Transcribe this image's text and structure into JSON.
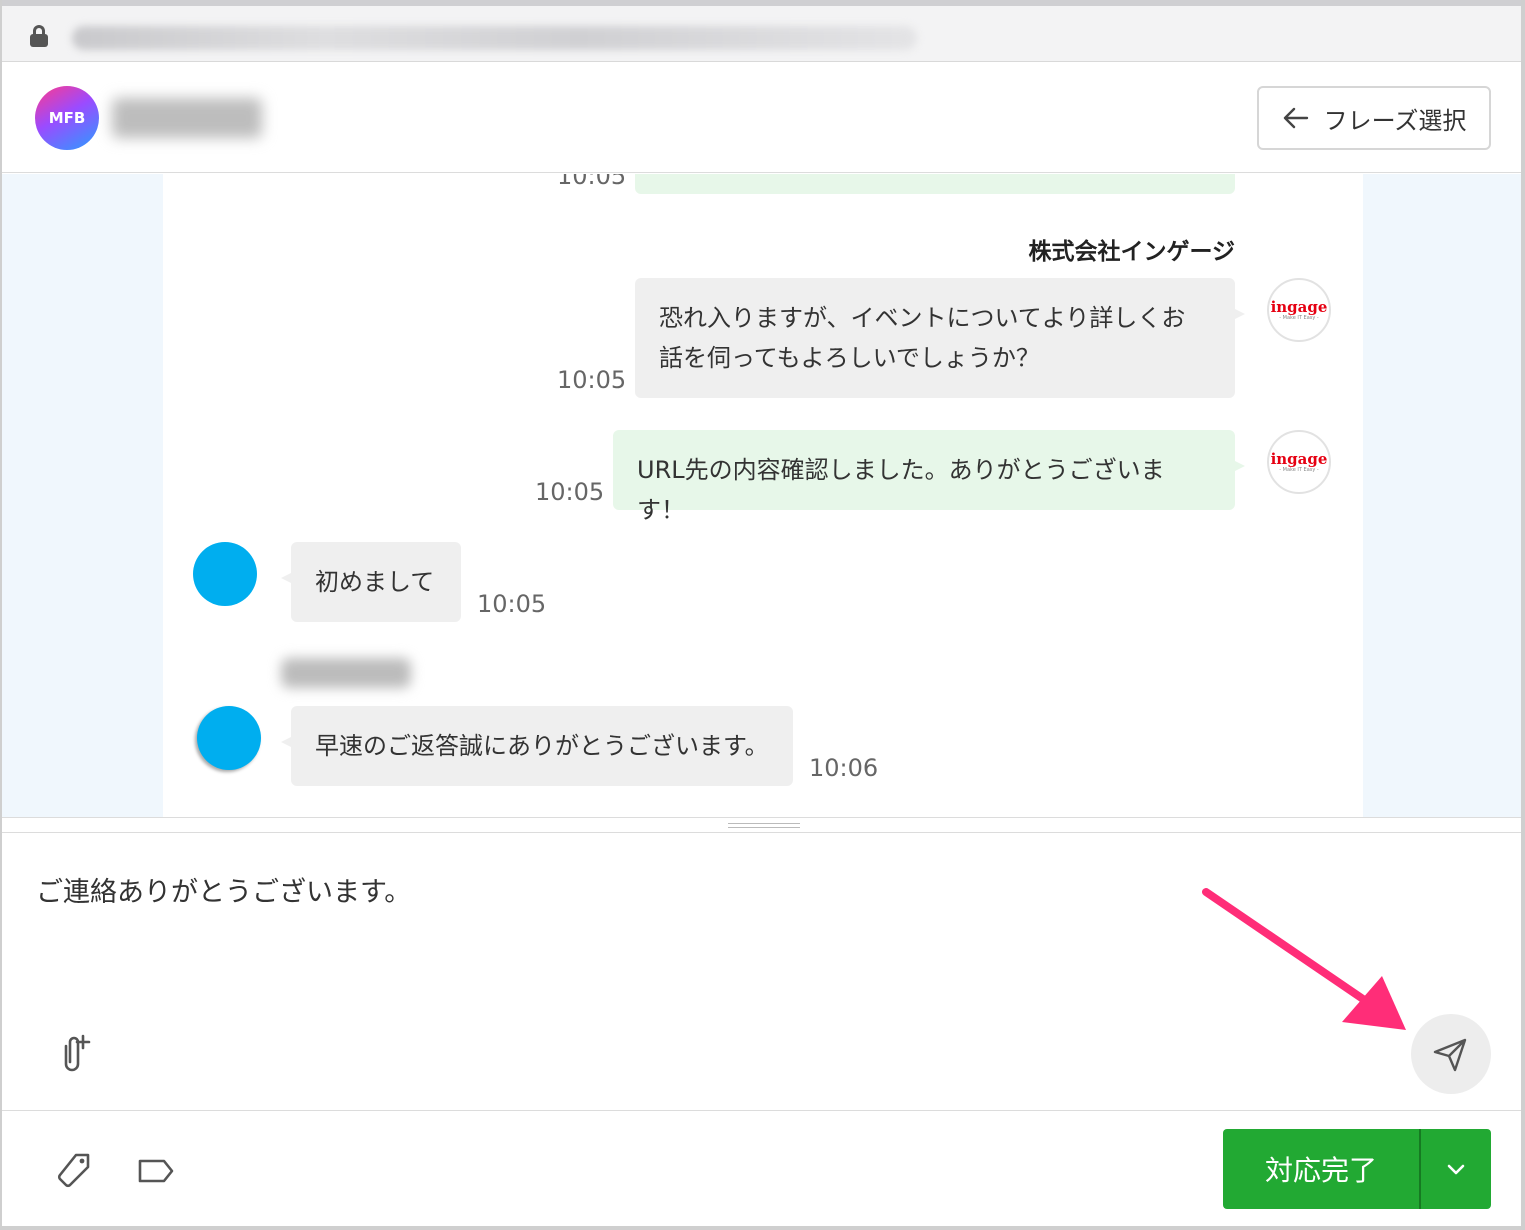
{
  "browser": {
    "url_blurred": true
  },
  "header": {
    "avatar_text": "MFB",
    "phrase_button_label": "フレーズ選択"
  },
  "chat": {
    "messages": [
      {
        "side": "right",
        "style": "green",
        "time": "10:05",
        "text": "",
        "partial": true
      },
      {
        "side": "right",
        "style": "gray",
        "sender": "株式会社インゲージ",
        "time": "10:05",
        "lines": [
          "恐れ入りますが、イベントについてより詳しくお",
          "話を伺ってもよろしいでしょうか？"
        ]
      },
      {
        "side": "right",
        "style": "green",
        "time": "10:05",
        "text": "URL先の内容確認しました。ありがとうございます！"
      },
      {
        "side": "left",
        "style": "gray",
        "time": "10:05",
        "text": "初めまして"
      },
      {
        "side": "left",
        "style": "gray",
        "time": "10:06",
        "text": "早速のご返答誠にありがとうございます。"
      }
    ],
    "agent_logo": {
      "brand": "ingage",
      "tagline": "- Make IT Easy -",
      "brand_color": "#e60012"
    },
    "customer_avatar_color": "#00aeef"
  },
  "composer": {
    "text": "ご連絡ありがとうございます。"
  },
  "footer": {
    "done_button_label": "対応完了",
    "done_color": "#22a933"
  },
  "annotation": {
    "arrow_color": "#ff2d78"
  }
}
